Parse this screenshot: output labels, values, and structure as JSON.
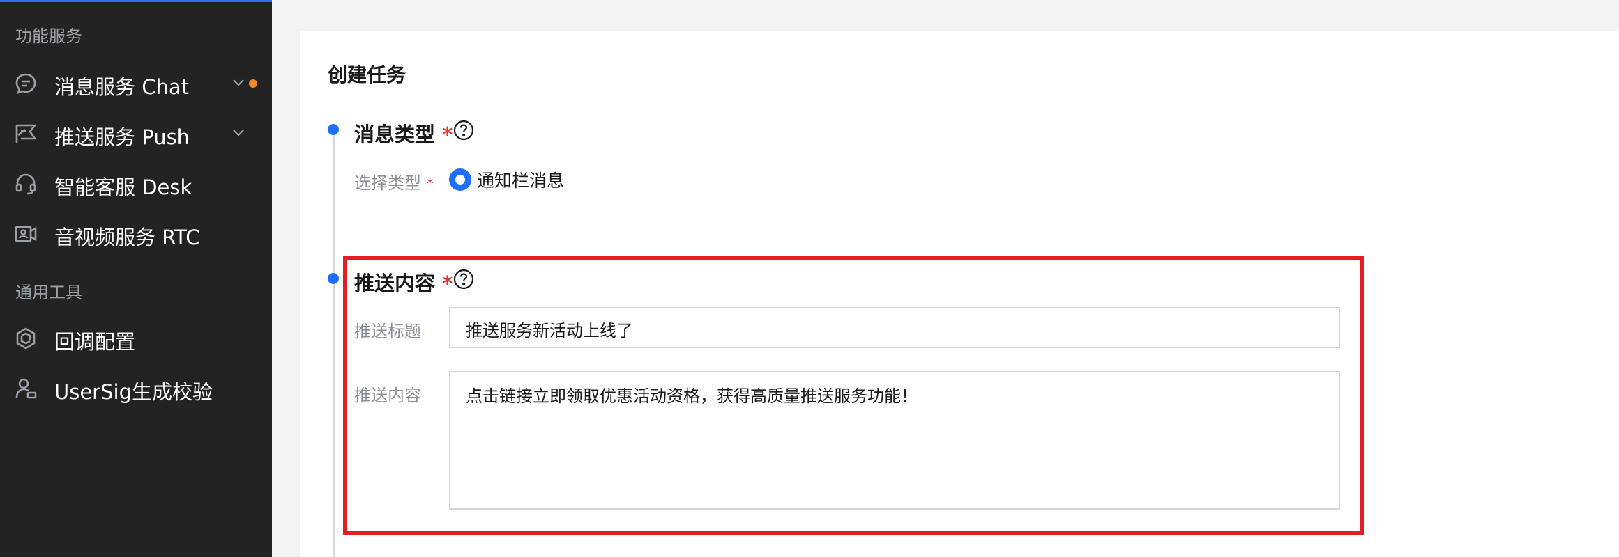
{
  "sidebar": {
    "section1_title": "功能服务",
    "items": [
      {
        "label": "消息服务 Chat",
        "icon": "chat-bubble-icon",
        "expandable": true,
        "has_dot": true
      },
      {
        "label": "推送服务 Push",
        "icon": "push-flag-icon",
        "expandable": true,
        "has_dot": false
      },
      {
        "label": "智能客服 Desk",
        "icon": "headset-icon",
        "expandable": false,
        "has_dot": false
      },
      {
        "label": "音视频服务 RTC",
        "icon": "video-camera-icon",
        "expandable": false,
        "has_dot": false
      }
    ],
    "section2_title": "通用工具",
    "tools": [
      {
        "label": "回调配置",
        "icon": "callback-config-icon"
      },
      {
        "label": "UserSig生成校验",
        "icon": "user-key-icon"
      }
    ],
    "colors": {
      "background": "#232323",
      "accent_dot": "#f38a30",
      "top_line": "#2f6fed"
    }
  },
  "main": {
    "title": "创建任务",
    "step1": {
      "title": "消息类型",
      "required_mark": "*",
      "type_label": "选择类型",
      "type_required": "*",
      "radio_option": "通知栏消息"
    },
    "step2": {
      "title": "推送内容",
      "required_mark": "*",
      "push_title_label": "推送标题",
      "push_title_value": "推送服务新活动上线了",
      "push_content_label": "推送内容",
      "push_content_value": "点击链接立即领取优惠活动资格，获得高质量推送服务功能！"
    },
    "colors": {
      "accent": "#1f6fff",
      "required": "#e3302f",
      "highlight_box": "#e31e24"
    }
  }
}
